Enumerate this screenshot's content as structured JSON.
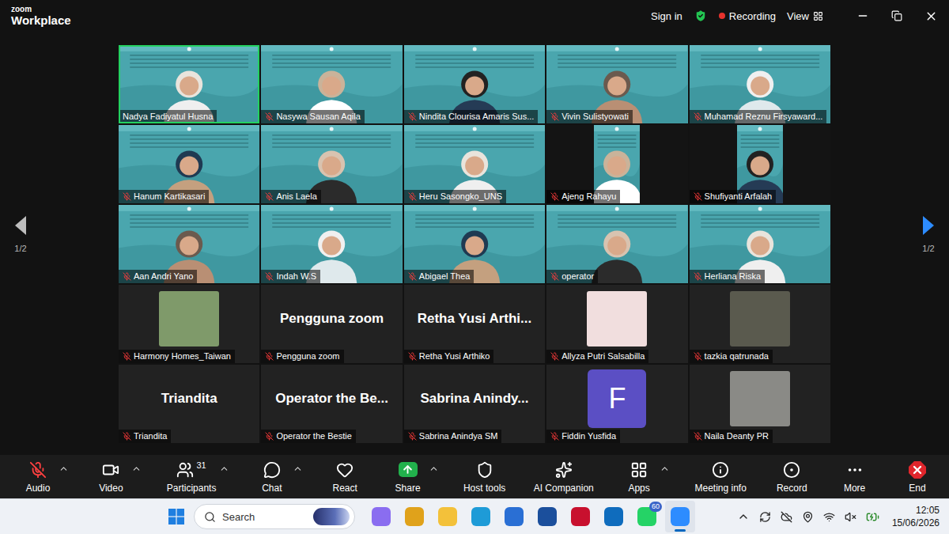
{
  "topbar": {
    "logo_top": "zoom",
    "logo_bottom": "Workplace",
    "sign_in": "Sign in",
    "recording": {
      "label": "Recording",
      "on": true
    },
    "view": "View"
  },
  "pager": {
    "left": {
      "label": "1/2",
      "enabled": false
    },
    "right": {
      "label": "1/2",
      "enabled": true
    }
  },
  "tiles": [
    {
      "name": "Nadya Fadiyatul Husna",
      "kind": "video",
      "muted": false,
      "active": true
    },
    {
      "name": "Nasywa Sausan Aqila",
      "kind": "video",
      "muted": true,
      "active": false
    },
    {
      "name": "Nindita Clourisa Amaris Sus...",
      "kind": "video",
      "muted": true,
      "active": false
    },
    {
      "name": "Vivin Sulistyowati",
      "kind": "video",
      "muted": true,
      "active": false
    },
    {
      "name": "Muhamad Reznu Firsyaward...",
      "kind": "video",
      "muted": true,
      "active": false
    },
    {
      "name": "Hanum Kartikasari",
      "kind": "video",
      "muted": true,
      "active": false
    },
    {
      "name": "Anis Laela",
      "kind": "video",
      "muted": true,
      "active": false
    },
    {
      "name": "Heru Sasongko_UNS",
      "kind": "video",
      "muted": true,
      "active": false
    },
    {
      "name": "Ajeng Rahayu",
      "kind": "video-portrait",
      "muted": true,
      "active": false
    },
    {
      "name": "Shufiyanti Arfalah",
      "kind": "video-portrait",
      "muted": true,
      "active": false
    },
    {
      "name": "Aan Andri Yano",
      "kind": "video",
      "muted": true,
      "active": false
    },
    {
      "name": "Indah W.S",
      "kind": "video",
      "muted": true,
      "active": false
    },
    {
      "name": "Abigael Thea",
      "kind": "video",
      "muted": true,
      "active": false
    },
    {
      "name": "operator",
      "kind": "video",
      "muted": true,
      "active": false
    },
    {
      "name": "Herliana Riska",
      "kind": "video",
      "muted": true,
      "active": false
    },
    {
      "name": "Harmony Homes_Taiwan",
      "kind": "picture",
      "muted": true,
      "active": false,
      "color": "#7f9a6a"
    },
    {
      "name": "Pengguna zoom",
      "kind": "name",
      "display": "Pengguna zoom",
      "muted": true,
      "active": false
    },
    {
      "name": "Retha Yusi Arthiko",
      "kind": "name",
      "display": "Retha Yusi Arthi...",
      "muted": true,
      "active": false
    },
    {
      "name": "Allyza Putri Salsabilla",
      "kind": "picture",
      "muted": true,
      "active": false,
      "color": "#f1dede"
    },
    {
      "name": "tazkia qatrunada",
      "kind": "picture",
      "muted": true,
      "active": false,
      "color": "#5a5a4e"
    },
    {
      "name": "Triandita",
      "kind": "name",
      "display": "Triandita",
      "muted": true,
      "active": false
    },
    {
      "name": "Operator the Bestie",
      "kind": "name",
      "display": "Operator the Be...",
      "muted": true,
      "active": false
    },
    {
      "name": "Sabrina Anindya SM",
      "kind": "name",
      "display": "Sabrina Anindy...",
      "muted": true,
      "active": false
    },
    {
      "name": "Fiddin Yusfida",
      "kind": "letter",
      "display": "F",
      "muted": true,
      "active": false,
      "color": "#5b4fc4"
    },
    {
      "name": "Naila Deanty PR",
      "kind": "picture",
      "muted": true,
      "active": false,
      "color": "#8a8a86"
    }
  ],
  "toolbar": [
    {
      "label": "Audio",
      "caret": true,
      "muted": true
    },
    {
      "label": "Video",
      "caret": true
    },
    {
      "label": "Participants",
      "caret": true,
      "count": "31"
    },
    {
      "label": "Chat",
      "caret": true
    },
    {
      "label": "React",
      "caret": false
    },
    {
      "label": "Share",
      "caret": true
    },
    {
      "label": "Host tools",
      "caret": false
    },
    {
      "label": "AI Companion",
      "caret": false
    },
    {
      "label": "Apps",
      "caret": true
    },
    {
      "label": "Meeting info",
      "caret": false
    },
    {
      "label": "Record",
      "caret": false
    },
    {
      "label": "More",
      "caret": false
    }
  ],
  "end": {
    "label": "End"
  },
  "taskbar": {
    "search": {
      "placeholder": "Search"
    },
    "apps": [
      {
        "active": false,
        "badge": "",
        "color": "#8a6df0"
      },
      {
        "active": false,
        "badge": "",
        "color": "#e0a21b"
      },
      {
        "active": false,
        "badge": "",
        "color": "#f3c13a"
      },
      {
        "active": false,
        "badge": "",
        "color": "#1e9bd7"
      },
      {
        "active": false,
        "badge": "",
        "color": "#2a6fd4"
      },
      {
        "active": false,
        "badge": "",
        "color": "#1b4f9c"
      },
      {
        "active": false,
        "badge": "",
        "color": "#c8102e"
      },
      {
        "active": false,
        "badge": "",
        "color": "#0f6cbd"
      },
      {
        "active": false,
        "badge": "60",
        "color": "#25d366"
      },
      {
        "active": true,
        "badge": "",
        "color": "#2d8cff"
      }
    ],
    "time": "12:05",
    "date": "15/06/2026"
  }
}
